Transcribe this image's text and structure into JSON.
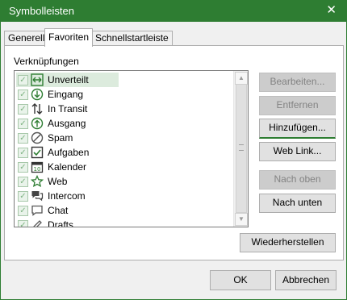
{
  "window": {
    "title": "Symbolleisten",
    "close_icon": "close-icon"
  },
  "tabs": [
    {
      "label": "Generell",
      "active": false
    },
    {
      "label": "Favoriten",
      "active": true
    },
    {
      "label": "Schnellstartleiste",
      "active": false
    }
  ],
  "section_label": "Verknüpfungen",
  "list": {
    "items": [
      {
        "label": "Unverteilt",
        "icon": "unverteilt-icon",
        "checked": true,
        "selected": true
      },
      {
        "label": "Eingang",
        "icon": "inbox-icon",
        "checked": true
      },
      {
        "label": "In Transit",
        "icon": "transit-icon",
        "checked": true
      },
      {
        "label": "Ausgang",
        "icon": "outbox-icon",
        "checked": true
      },
      {
        "label": "Spam",
        "icon": "spam-icon",
        "checked": true
      },
      {
        "label": "Aufgaben",
        "icon": "tasks-icon",
        "checked": true
      },
      {
        "label": "Kalender",
        "icon": "calendar-icon",
        "checked": true,
        "calendar_day": "10"
      },
      {
        "label": "Web",
        "icon": "web-star-icon",
        "checked": true
      },
      {
        "label": "Intercom",
        "icon": "intercom-icon",
        "checked": true
      },
      {
        "label": "Chat",
        "icon": "chat-icon",
        "checked": true
      },
      {
        "label": "Drafts",
        "icon": "drafts-icon",
        "checked": true
      }
    ]
  },
  "buttons": {
    "bearbeiten": "Bearbeiten...",
    "entfernen": "Entfernen",
    "hinzufuegen": "Hinzufügen...",
    "weblink": "Web Link...",
    "nach_oben": "Nach oben",
    "nach_unten": "Nach unten",
    "wiederherstellen": "Wiederherstellen"
  },
  "footer": {
    "ok": "OK",
    "abbrechen": "Abbrechen"
  },
  "colors": {
    "accent": "#2e7d32",
    "selection": "#dcebdd",
    "disabled_button": "#cccccc"
  }
}
